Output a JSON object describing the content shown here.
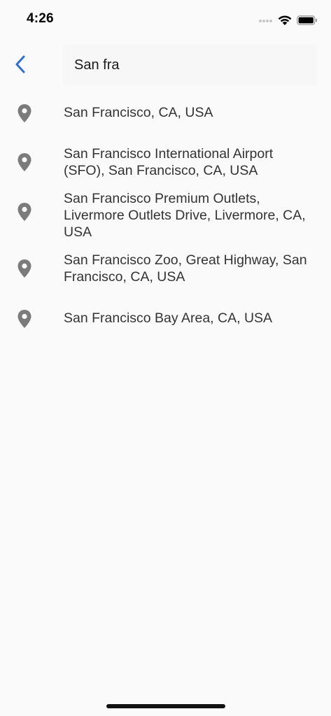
{
  "status_bar": {
    "time": "4:26"
  },
  "search": {
    "value": "San fra",
    "placeholder": ""
  },
  "colors": {
    "accent": "#2f6fd6",
    "pin": "#7b7b7b",
    "background": "#fafafa"
  },
  "results": [
    {
      "label": "San Francisco, CA, USA",
      "icon": "location-pin-icon"
    },
    {
      "label": "San Francisco International Airport (SFO), San Francisco, CA, USA",
      "icon": "location-pin-icon"
    },
    {
      "label": "San Francisco Premium Outlets, Livermore Outlets Drive, Livermore, CA, USA",
      "icon": "location-pin-icon"
    },
    {
      "label": "San Francisco Zoo, Great Highway, San Francisco, CA, USA",
      "icon": "location-pin-icon"
    },
    {
      "label": "San Francisco Bay Area, CA, USA",
      "icon": "location-pin-icon"
    }
  ]
}
